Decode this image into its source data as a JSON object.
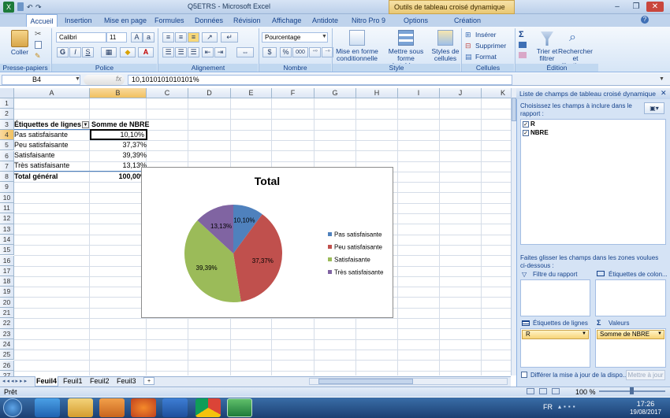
{
  "window": {
    "title": "Q5ETRS - Microsoft Excel",
    "context_tab": "Outils de tableau croisé dynamique"
  },
  "tabs": [
    "Accueil",
    "Insertion",
    "Mise en page",
    "Formules",
    "Données",
    "Révision",
    "Affichage",
    "Antidote",
    "Nitro Pro 9",
    "Options",
    "Création"
  ],
  "ribbon": {
    "clipboard": {
      "label": "Presse-papiers",
      "paste": "Coller"
    },
    "font": {
      "label": "Police",
      "name": "Calibri",
      "size": "11",
      "bold": "G",
      "italic": "I",
      "underline": "S"
    },
    "alignment": {
      "label": "Alignement"
    },
    "number": {
      "label": "Nombre",
      "format": "Pourcentage",
      "percent": "%",
      "thousands": "000"
    },
    "style": {
      "label": "Style",
      "cond": "Mise en forme\nconditionnelle",
      "table": "Mettre sous forme\nde tableau",
      "cell": "Styles de\ncellules"
    },
    "cells": {
      "label": "Cellules",
      "insert": "Insérer",
      "delete": "Supprimer",
      "format": "Format"
    },
    "edit": {
      "label": "Édition",
      "sort": "Trier et\nfiltrer",
      "find": "Rechercher et\nsélectionner"
    }
  },
  "formula": {
    "cell": "B4",
    "fx": "fx",
    "value": "10,1010101010101%"
  },
  "columns": [
    "A",
    "B",
    "C",
    "D",
    "E",
    "F",
    "G",
    "H",
    "I",
    "J",
    "K"
  ],
  "rows": [
    "1",
    "2",
    "3",
    "4",
    "5",
    "6",
    "7",
    "8",
    "9",
    "10",
    "11",
    "12",
    "13",
    "14",
    "15",
    "16",
    "17",
    "18",
    "19",
    "20",
    "21",
    "22",
    "23",
    "24",
    "25",
    "26",
    "27"
  ],
  "pivot": {
    "header_a": "Étiquettes de lignes",
    "header_b": "Somme de NBRE",
    "data": [
      {
        "label": "Pas satisfaisante",
        "value": "10,10%"
      },
      {
        "label": "Peu satisfaisante",
        "value": "37,37%"
      },
      {
        "label": "Satisfaisante",
        "value": "39,39%"
      },
      {
        "label": "Très satisfaisante",
        "value": "13,13%"
      }
    ],
    "total_label": "Total général",
    "total_value": "100,00%"
  },
  "chart_data": {
    "type": "pie",
    "title": "Total",
    "categories": [
      "Pas satisfaisante",
      "Peu satisfaisante",
      "Satisfaisante",
      "Très satisfaisante"
    ],
    "values": [
      10.1,
      37.37,
      39.39,
      13.13
    ],
    "labels": [
      "10,10%",
      "37,37%",
      "39,39%",
      "13,13%"
    ],
    "colors": [
      "#4f81bd",
      "#c0504d",
      "#9bbb59",
      "#8064a2"
    ],
    "legend": "right"
  },
  "sheets": [
    "Feuil4",
    "Feuil1",
    "Feuil2",
    "Feuil3"
  ],
  "status": {
    "text": "Prêt",
    "zoom": "100 %"
  },
  "pane": {
    "title": "Liste de champs de tableau croisé dynamique",
    "choose": "Choisissez les champs à inclure dans le rapport :",
    "fields": [
      "R",
      "NBRE"
    ],
    "drag": "Faites glisser les champs dans les zones voulues ci-dessous :",
    "report_filter": "Filtre du rapport",
    "col_labels": "Étiquettes de colon...",
    "row_labels": "Étiquettes de lignes",
    "values": "Valeurs",
    "row_item": "R",
    "value_item": "Somme de NBRE",
    "defer": "Différer la mise à jour de la dispo...",
    "update": "Mettre à jour"
  },
  "taskbar": {
    "lang": "FR",
    "time": "17:26",
    "date": "19/08/2017"
  }
}
